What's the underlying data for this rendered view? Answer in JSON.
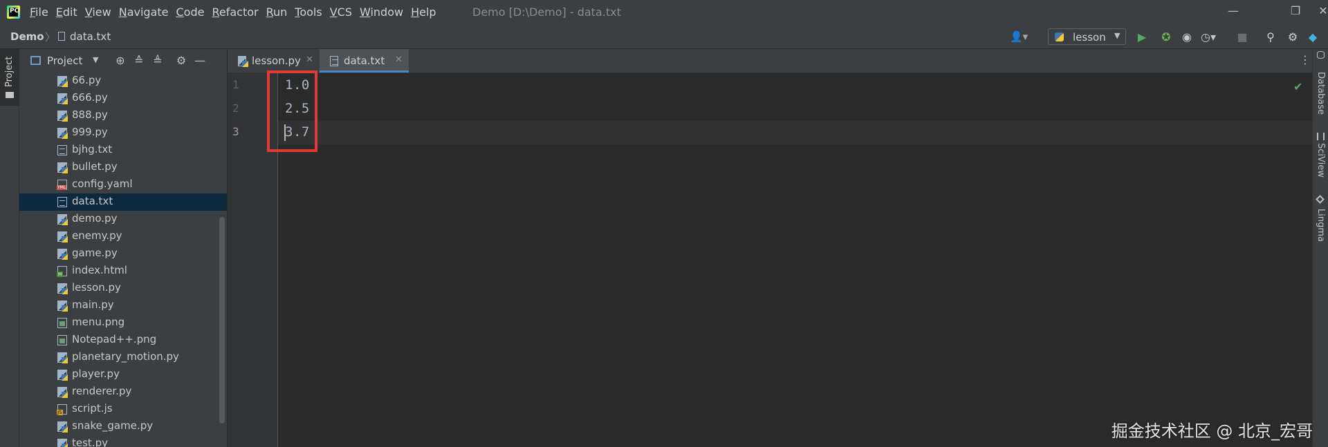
{
  "titlebar": {
    "menu": [
      "File",
      "Edit",
      "View",
      "Navigate",
      "Code",
      "Refactor",
      "Run",
      "Tools",
      "VCS",
      "Window",
      "Help"
    ],
    "window_title": "Demo [D:\\Demo] - data.txt",
    "minimize": "—",
    "restore": "❐",
    "close": "✕"
  },
  "navbar": {
    "project": "Demo",
    "separator": "〉",
    "file": "data.txt",
    "run_config": "lesson"
  },
  "left_stripe": {
    "project_tab": "Project"
  },
  "project_panel": {
    "title": "Project",
    "files": [
      {
        "name": "66.py",
        "type": "py"
      },
      {
        "name": "666.py",
        "type": "py"
      },
      {
        "name": "888.py",
        "type": "py"
      },
      {
        "name": "999.py",
        "type": "py"
      },
      {
        "name": "bjhg.txt",
        "type": "txt"
      },
      {
        "name": "bullet.py",
        "type": "py"
      },
      {
        "name": "config.yaml",
        "type": "yaml"
      },
      {
        "name": "data.txt",
        "type": "txt",
        "selected": true
      },
      {
        "name": "demo.py",
        "type": "py"
      },
      {
        "name": "enemy.py",
        "type": "py"
      },
      {
        "name": "game.py",
        "type": "py"
      },
      {
        "name": "index.html",
        "type": "html"
      },
      {
        "name": "lesson.py",
        "type": "py"
      },
      {
        "name": "main.py",
        "type": "py"
      },
      {
        "name": "menu.png",
        "type": "png"
      },
      {
        "name": "Notepad++.png",
        "type": "png"
      },
      {
        "name": "planetary_motion.py",
        "type": "py"
      },
      {
        "name": "player.py",
        "type": "py"
      },
      {
        "name": "renderer.py",
        "type": "py"
      },
      {
        "name": "script.js",
        "type": "js"
      },
      {
        "name": "snake_game.py",
        "type": "py"
      },
      {
        "name": "test.py",
        "type": "py"
      }
    ]
  },
  "tabs": [
    {
      "label": "lesson.py",
      "type": "py",
      "active": false
    },
    {
      "label": "data.txt",
      "type": "txt",
      "active": true
    }
  ],
  "editor": {
    "line_numbers": [
      "1",
      "2",
      "3"
    ],
    "lines": [
      "1.0",
      "2.5",
      "3.7"
    ],
    "current_line": 3
  },
  "right_stripe": {
    "tabs": [
      "Database",
      "SciView",
      "Lingma"
    ]
  },
  "watermark": "掘金技术社区 @ 北京_宏哥",
  "colors": {
    "background": "#2b2b2b",
    "chrome": "#3c3f41",
    "selection": "#0d293e",
    "accent": "#4a88c7",
    "highlight_box": "#e53935",
    "run_green": "#59a869"
  }
}
